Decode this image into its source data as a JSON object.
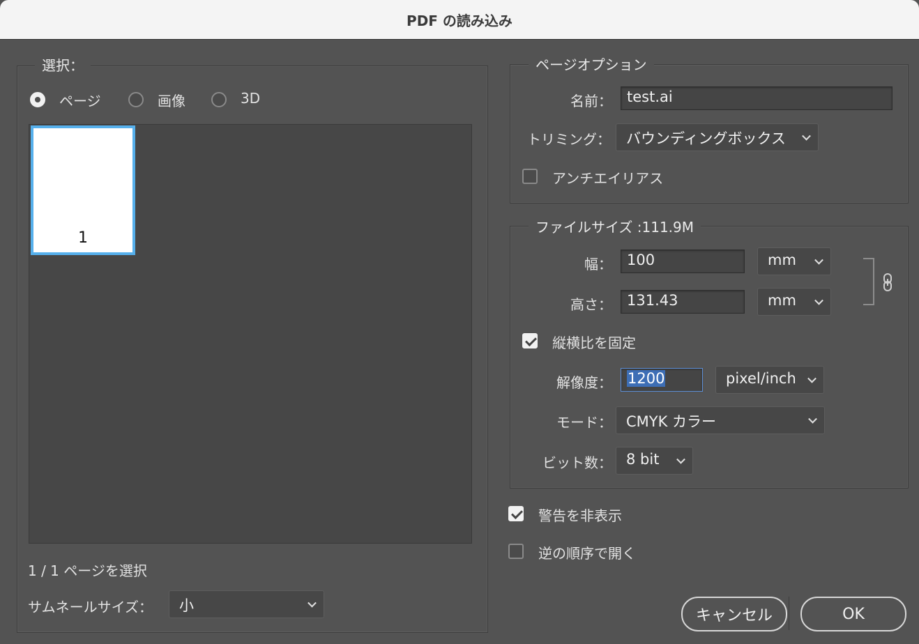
{
  "window": {
    "title": "PDF の読み込み"
  },
  "select_group": {
    "legend": "選択：",
    "options": [
      {
        "label": "ページ",
        "selected": true
      },
      {
        "label": "画像",
        "selected": false
      },
      {
        "label": "3D",
        "selected": false
      }
    ],
    "thumbnail_page_number": "1",
    "selection_status": "1 / 1 ページを選択",
    "thumbnail_size_label": "サムネールサイズ：",
    "thumbnail_size_value": "小"
  },
  "page_options": {
    "legend": "ページオプション",
    "name_label": "名前：",
    "name_value": "test.ai",
    "crop_label": "トリミング：",
    "crop_value": "バウンディングボックス",
    "antialias_label": "アンチエイリアス",
    "antialias_checked": false
  },
  "file_size": {
    "legend": "ファイルサイズ :111.9M",
    "width_label": "幅：",
    "width_value": "100",
    "width_unit": "mm",
    "height_label": "高さ：",
    "height_value": "131.43",
    "height_unit": "mm",
    "constrain_label": "縦横比を固定",
    "constrain_checked": true,
    "resolution_label": "解像度：",
    "resolution_value": "1200",
    "resolution_unit": "pixel/inch",
    "mode_label": "モード：",
    "mode_value": "CMYK カラー",
    "bits_label": "ビット数：",
    "bits_value": "8 bit"
  },
  "suppress_warnings": {
    "label": "警告を非表示",
    "checked": true
  },
  "reverse_order": {
    "label": "逆の順序で開く",
    "checked": false
  },
  "buttons": {
    "cancel": "キャンセル",
    "ok": "OK"
  },
  "colors": {
    "background": "#535353",
    "selection_blue": "#56b0ec",
    "text_highlight": "#3d6eb5"
  }
}
